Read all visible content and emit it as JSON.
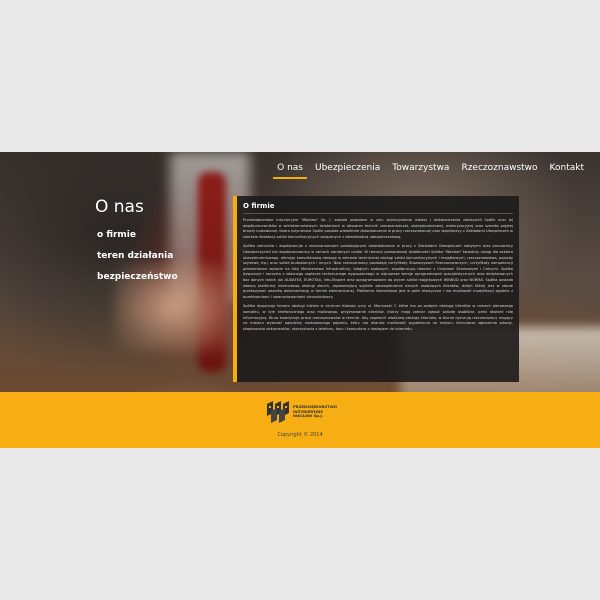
{
  "nav": {
    "items": [
      {
        "label": "O nas",
        "active": true
      },
      {
        "label": "Ubezpieczenia",
        "active": false
      },
      {
        "label": "Towarzystwa",
        "active": false
      },
      {
        "label": "Rzeczoznawstwo",
        "active": false
      },
      {
        "label": "Kontakt",
        "active": false
      }
    ]
  },
  "sidebar": {
    "title": "O nas",
    "items": [
      {
        "label": "o firmie"
      },
      {
        "label": "teren działania"
      },
      {
        "label": "bezpieczeństwo"
      }
    ]
  },
  "content": {
    "heading": "O firmie",
    "paragraphs": [
      "Przedsiębiorstwo Inżynieryjne \"Wacław\" Sp. J. zostało powołane w celu wykorzystania wiedzy i doświadczenia założycieli Spółki oraz jej współpracowników w wielokierunkowych działaniach w obszarze technik rzeczoznawczej, ubezpieczeniowej, motoryzacyjnej oraz szeroko pojętej branży budowlanej. Kadra inżynierska Spółki posiada wieloletnie doświadczenie w pracy rzeczoznawczej oraz współpracy z Zakładami Ubezpieczeń w zakresie likwidacji szkód komunikacyjnych związanych z działalnością ubezpieczeniową.",
      "Spółka zatrudnia i współpracuje z rzeczoznawcami posiadającymi doświadczenie w pracy z Zakładami Ubezpieczeń nabytymi oraz pracownicy Ubezpieczycieli lub współpracownicy w ramach odrębnych umów. W ramach prowadzonej działalności Spółka \"Wacław\" świadczy usługi dla sektora ubezpieczeniowego, oferując kompleksową obsługę w zakresie technicznej obsługi szkód komunikacyjnych i majątkowych, rzeczoznawstwa, pojazdy szynowe, itp.) oraz szkód budowlanych i innych. Nasi rzeczoznawcy posiadają certyfikaty Stowarzyszeń Rzeczoznawczych, certyfikaty kompetencji potwierdzone wpisem na listę Ministerstwa Infrastruktury, biegłych sądowych, współpracują również z Urzędami Skarbowymi i Celnymi. Spółka dysponuje i korzysta z własnego zaplecza technicznego wyposażonego w najnowsze wersje oprogramowań specjalistycznych oraz dedykowanych baz danych takich jak AUDATEX, EUROTAX, Info-Ekspert oraz oprogramowanie do wycen szkód majątkowych WINBUD oraz NORMA. Spółka posiada własną platformę internetową obsługi zleceń, zapewniającą szybkie zabezpieczenie danych osobowych klientów, dzięki której jest w stanie przekazywać wszelką dokumentację w formie elektronicznej. Platforma internetowa jest w pełni elastyczna i ma możliwość modyfikacji zgodnie z oczekiwaniami i uwarunkowaniami zleceniodawcy.",
      "Spółka dysponuje biurem obsługi klienta w centrum Katowic przy ul. Moniuszki 7, które ma za zadanie obsługę klientów w ramach pierwszego kontaktu, w tym telefonicznego oraz mailowego, przyjmowanie klientów, którzy mają zamiar zgłosić szkodę osobiście, pełni również rolę informacyjną. Biuro koordynuje pracę rzeczoznawców w terenie. Aby zapewnić właściwą obsługę klientów, w biurze dyżurują rzeczoznawcy mogący na miejscu wykonać oględziny uszkodzonego pojazdu, który ma również możliwość wypełnienia na miejscu formularza zgłoszenia szkody, skopiowania dokumentów, skorzystania z telefonu, faxu i komputera z dostępem do internetu."
    ]
  },
  "footer": {
    "logo_lines": [
      "PRZEDSIĘBIORSTWO",
      "INŻYNIERYJNE",
      "WACŁAW Sp.J."
    ],
    "copyright": "Copyright © 2014"
  },
  "colors": {
    "accent": "#f6ae13",
    "panel": "#1c1b1b",
    "background": "#e9e9e9"
  }
}
